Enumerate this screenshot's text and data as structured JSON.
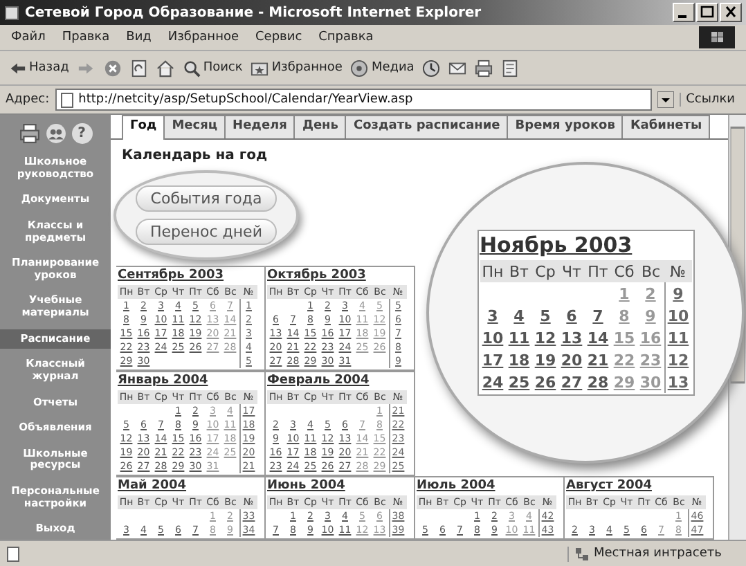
{
  "window": {
    "title": "Сетевой Город Образование - Microsoft Internet Explorer"
  },
  "menu": [
    "Файл",
    "Правка",
    "Вид",
    "Избранное",
    "Сервис",
    "Справка"
  ],
  "toolbar": [
    {
      "kind": "back",
      "label": "Назад"
    },
    {
      "kind": "forward"
    },
    {
      "kind": "stop"
    },
    {
      "kind": "refresh"
    },
    {
      "kind": "home"
    },
    {
      "kind": "search",
      "label": "Поиск"
    },
    {
      "kind": "favorites",
      "label": "Избранное"
    },
    {
      "kind": "media",
      "label": "Медиа"
    },
    {
      "kind": "history"
    },
    {
      "kind": "mail"
    },
    {
      "kind": "print"
    },
    {
      "kind": "edit"
    }
  ],
  "address": {
    "label": "Адрес:",
    "value": "http://netcity/asp/SetupSchool/Calendar/YearView.asp",
    "links": "Ссылки"
  },
  "sidebar": {
    "tools": [
      {
        "kind": "print"
      },
      {
        "kind": "users"
      },
      {
        "kind": "help",
        "label": "?"
      }
    ],
    "items": [
      {
        "label": "Школьное руководство",
        "selected": false
      },
      {
        "label": "Документы",
        "selected": false
      },
      {
        "label": "Классы и предметы",
        "selected": false
      },
      {
        "label": "Планирование уроков",
        "selected": false
      },
      {
        "label": "Учебные материалы",
        "selected": false
      },
      {
        "label": "Расписание",
        "selected": true
      },
      {
        "label": "Классный журнал",
        "selected": false
      },
      {
        "label": "Отчеты",
        "selected": false
      },
      {
        "label": "Объявления",
        "selected": false
      },
      {
        "label": "Школьные ресурсы",
        "selected": false
      },
      {
        "label": "Персональные настройки",
        "selected": false
      },
      {
        "label": "Выход",
        "selected": false
      }
    ]
  },
  "tabs": [
    {
      "label": "Год",
      "selected": true
    },
    {
      "label": "Месяц",
      "selected": false
    },
    {
      "label": "Неделя",
      "selected": false
    },
    {
      "label": "День",
      "selected": false
    },
    {
      "label": "Создать расписание",
      "selected": false
    },
    {
      "label": "Время уроков",
      "selected": false
    },
    {
      "label": "Кабинеты",
      "selected": false
    }
  ],
  "page_title": "Календарь на год",
  "actions": [
    "События года",
    "Перенос дней"
  ],
  "calendar": {
    "upper": [
      {
        "title": "Сентябрь 2003",
        "header": [
          "Пн",
          "Вт",
          "Ср",
          "Чт",
          "Пт",
          "Сб",
          "Вс",
          "№"
        ],
        "weeks": [
          {
            "days": [
              "1",
              "2",
              "3",
              "4",
              "5",
              "6",
              "7"
            ],
            "no": "1"
          },
          {
            "days": [
              "8",
              "9",
              "10",
              "11",
              "12",
              "13",
              "14"
            ],
            "no": "2"
          },
          {
            "days": [
              "15",
              "16",
              "17",
              "18",
              "19",
              "20",
              "21"
            ],
            "no": "3"
          },
          {
            "days": [
              "22",
              "23",
              "24",
              "25",
              "26",
              "27",
              "28"
            ],
            "no": "4"
          },
          {
            "days": [
              "29",
              "30"
            ],
            "no": "5"
          }
        ]
      },
      {
        "title": "Октябрь 2003",
        "header": [
          "Пн",
          "Вт",
          "Ср",
          "Чт",
          "Пт",
          "Сб",
          "Вс",
          "№"
        ],
        "weeks": [
          {
            "days": [
              "1",
              "2",
              "3",
              "4",
              "5"
            ],
            "no": "5"
          },
          {
            "days": [
              "6",
              "7",
              "8",
              "9",
              "10",
              "11",
              "12"
            ],
            "no": "6"
          },
          {
            "days": [
              "13",
              "14",
              "15",
              "16",
              "17",
              "18",
              "19"
            ],
            "no": "7"
          },
          {
            "days": [
              "20",
              "21",
              "22",
              "23",
              "24",
              "25",
              "26"
            ],
            "no": "8"
          },
          {
            "days": [
              "27",
              "28",
              "29",
              "30",
              "31"
            ],
            "no": "9"
          }
        ]
      },
      {
        "title": "Январь 2004",
        "header": [
          "Пн",
          "Вт",
          "Ср",
          "Чт",
          "Пт",
          "Сб",
          "Вс",
          "№"
        ],
        "weeks": [
          {
            "days": [
              "1",
              "2",
              "3",
              "4"
            ],
            "no": "17"
          },
          {
            "days": [
              "5",
              "6",
              "7",
              "8",
              "9",
              "10",
              "11"
            ],
            "no": "18"
          },
          {
            "days": [
              "12",
              "13",
              "14",
              "15",
              "16",
              "17",
              "18"
            ],
            "no": "19"
          },
          {
            "days": [
              "19",
              "20",
              "21",
              "22",
              "23",
              "24",
              "25"
            ],
            "no": "20"
          },
          {
            "days": [
              "26",
              "27",
              "28",
              "29",
              "30",
              "31"
            ],
            "no": "21"
          }
        ]
      },
      {
        "title": "Февраль 2004",
        "header": [
          "Пн",
          "Вт",
          "Ср",
          "Чт",
          "Пт",
          "Сб",
          "Вс",
          "№"
        ],
        "weeks": [
          {
            "days": [
              "1"
            ],
            "no": "21"
          },
          {
            "days": [
              "2",
              "3",
              "4",
              "5",
              "6",
              "7",
              "8"
            ],
            "no": "22"
          },
          {
            "days": [
              "9",
              "10",
              "11",
              "12",
              "13",
              "14",
              "15"
            ],
            "no": "23"
          },
          {
            "days": [
              "16",
              "17",
              "18",
              "19",
              "20",
              "21",
              "22"
            ],
            "no": "24"
          },
          {
            "days": [
              "23",
              "24",
              "25",
              "26",
              "27",
              "28",
              "29"
            ],
            "no": "25"
          }
        ]
      }
    ],
    "lower": [
      {
        "title": "Май 2004",
        "header": [
          "Пн",
          "Вт",
          "Ср",
          "Чт",
          "Пт",
          "Сб",
          "Вс",
          "№"
        ],
        "weeks": [
          {
            "days": [
              "1",
              "2"
            ],
            "no": "33"
          },
          {
            "days": [
              "3",
              "4",
              "5",
              "6",
              "7",
              "8",
              "9"
            ],
            "no": "34"
          }
        ]
      },
      {
        "title": "Июнь 2004",
        "header": [
          "Пн",
          "Вт",
          "Ср",
          "Чт",
          "Пт",
          "Сб",
          "Вс",
          "№"
        ],
        "weeks": [
          {
            "days": [
              "1",
              "2",
              "3",
              "4",
              "5",
              "6"
            ],
            "no": "38"
          },
          {
            "days": [
              "7",
              "8",
              "9",
              "10",
              "11",
              "12",
              "13"
            ],
            "no": "39"
          }
        ]
      },
      {
        "title": "Июль 2004",
        "header": [
          "Пн",
          "Вт",
          "Ср",
          "Чт",
          "Пт",
          "Сб",
          "Вс",
          "№"
        ],
        "weeks": [
          {
            "days": [
              "1",
              "2",
              "3",
              "4"
            ],
            "no": "42"
          },
          {
            "days": [
              "5",
              "6",
              "7",
              "8",
              "9",
              "10",
              "11"
            ],
            "no": "43"
          }
        ]
      },
      {
        "title": "Август 2004",
        "header": [
          "Пн",
          "Вт",
          "Ср",
          "Чт",
          "Пт",
          "Сб",
          "Вс",
          "№"
        ],
        "weeks": [
          {
            "days": [
              "1"
            ],
            "no": "46"
          },
          {
            "days": [
              "2",
              "3",
              "4",
              "5",
              "6",
              "7",
              "8"
            ],
            "no": "47"
          }
        ]
      }
    ],
    "magnified": {
      "title": "Ноябрь 2003",
      "header": [
        "Пн",
        "Вт",
        "Ср",
        "Чт",
        "Пт",
        "Сб",
        "Вс",
        "№"
      ],
      "weeks": [
        {
          "days": [
            "1",
            "2"
          ],
          "no": "9"
        },
        {
          "days": [
            "3",
            "4",
            "5",
            "6",
            "7",
            "8",
            "9"
          ],
          "no": "10"
        },
        {
          "days": [
            "10",
            "11",
            "12",
            "13",
            "14",
            "15",
            "16"
          ],
          "no": "11"
        },
        {
          "days": [
            "17",
            "18",
            "19",
            "20",
            "21",
            "22",
            "23"
          ],
          "no": "12"
        },
        {
          "days": [
            "24",
            "25",
            "26",
            "27",
            "28",
            "29",
            "30"
          ],
          "no": "13"
        }
      ]
    }
  },
  "status_bar": {
    "zone": "Местная интрасеть"
  }
}
